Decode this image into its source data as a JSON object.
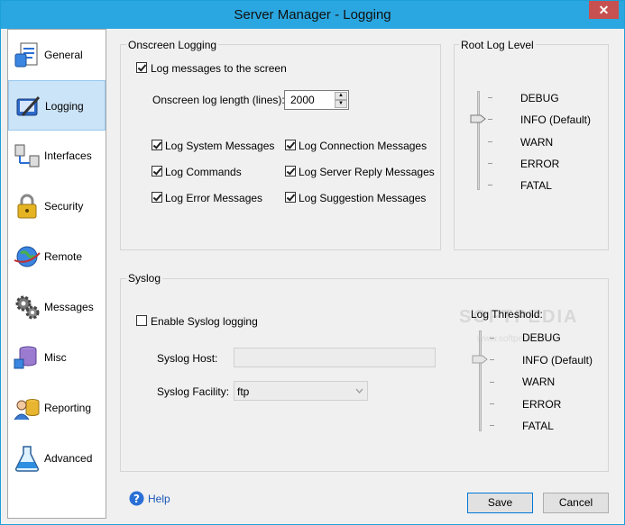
{
  "window": {
    "title": "Server Manager - Logging",
    "close_label": "✕"
  },
  "sidebar": {
    "items": [
      {
        "label": "General"
      },
      {
        "label": "Logging"
      },
      {
        "label": "Interfaces"
      },
      {
        "label": "Security"
      },
      {
        "label": "Remote"
      },
      {
        "label": "Messages"
      },
      {
        "label": "Misc"
      },
      {
        "label": "Reporting"
      },
      {
        "label": "Advanced"
      }
    ],
    "active": "Logging"
  },
  "onscreen": {
    "title": "Onscreen Logging",
    "log_to_screen": "Log messages to the screen",
    "length_label": "Onscreen log length (lines):",
    "length_value": "2000",
    "checkboxes": [
      "Log System Messages",
      "Log Connection Messages",
      "Log Commands",
      "Log Server Reply Messages",
      "Log Error Messages",
      "Log Suggestion Messages"
    ]
  },
  "root_level": {
    "title": "Root Log Level",
    "levels": [
      "DEBUG",
      "INFO (Default)",
      "WARN",
      "ERROR",
      "FATAL"
    ],
    "selected": "INFO (Default)"
  },
  "syslog": {
    "title": "Syslog",
    "enable_label": "Enable Syslog logging",
    "host_label": "Syslog Host:",
    "host_value": "",
    "facility_label": "Syslog Facility:",
    "facility_value": "ftp",
    "threshold_title": "Log Threshold:",
    "levels": [
      "DEBUG",
      "INFO (Default)",
      "WARN",
      "ERROR",
      "FATAL"
    ],
    "selected": "INFO (Default)"
  },
  "watermark": {
    "text": "SOFTPEDIA",
    "url": "www.softpedia.com"
  },
  "footer": {
    "help": "Help",
    "save": "Save",
    "cancel": "Cancel"
  }
}
